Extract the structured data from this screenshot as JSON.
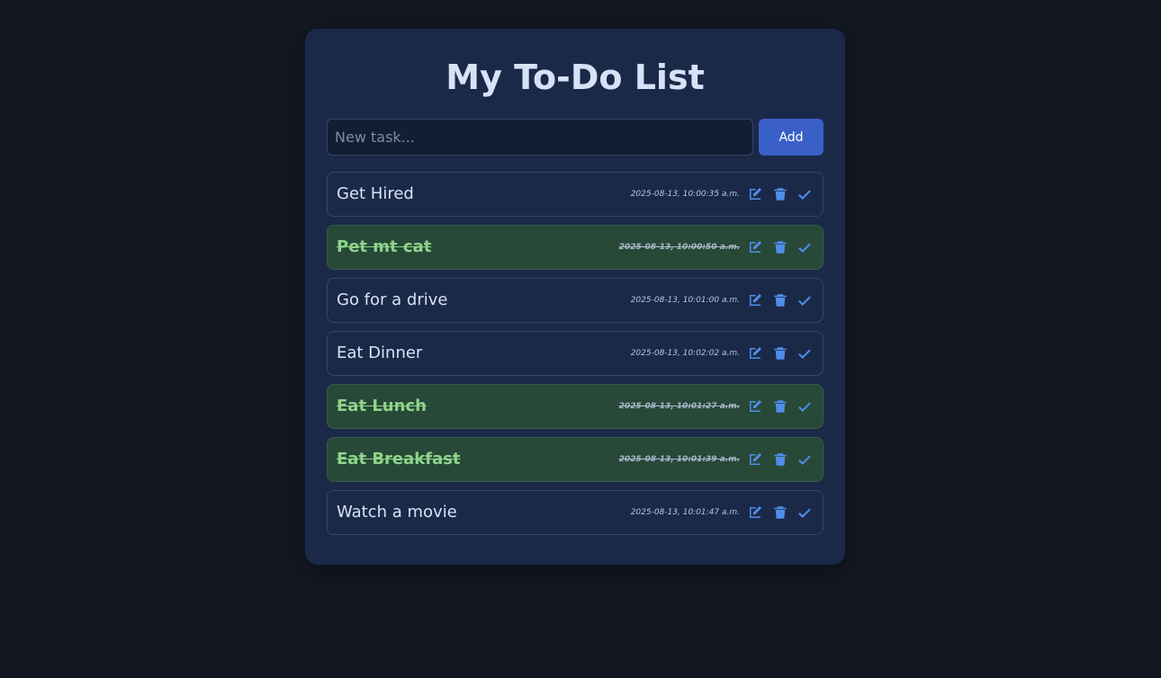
{
  "app": {
    "title": "My To-Do List"
  },
  "input": {
    "placeholder": "New task...",
    "value": ""
  },
  "add_button": {
    "label": "Add"
  },
  "colors": {
    "page_bg": "#121722",
    "card_bg": "#1b2949",
    "accent": "#3a5fc8",
    "icon": "#4f8ee8",
    "done_bg": "#284838",
    "done_text": "#8fd48a"
  },
  "icons": {
    "edit": "edit-icon",
    "delete": "trash-icon",
    "complete": "check-icon"
  },
  "tasks": [
    {
      "text": "Get Hired",
      "timestamp": "2025-08-13, 10:00:35 a.m.",
      "done": false
    },
    {
      "text": "Pet mt cat",
      "timestamp": "2025-08-13, 10:00:50 a.m.",
      "done": true
    },
    {
      "text": "Go for a drive",
      "timestamp": "2025-08-13, 10:01:00 a.m.",
      "done": false
    },
    {
      "text": "Eat Dinner",
      "timestamp": "2025-08-13, 10:02:02 a.m.",
      "done": false
    },
    {
      "text": "Eat Lunch",
      "timestamp": "2025-08-13, 10:01:27 a.m.",
      "done": true
    },
    {
      "text": "Eat Breakfast",
      "timestamp": "2025-08-13, 10:01:39 a.m.",
      "done": true
    },
    {
      "text": "Watch a movie",
      "timestamp": "2025-08-13, 10:01:47 a.m.",
      "done": false
    }
  ]
}
